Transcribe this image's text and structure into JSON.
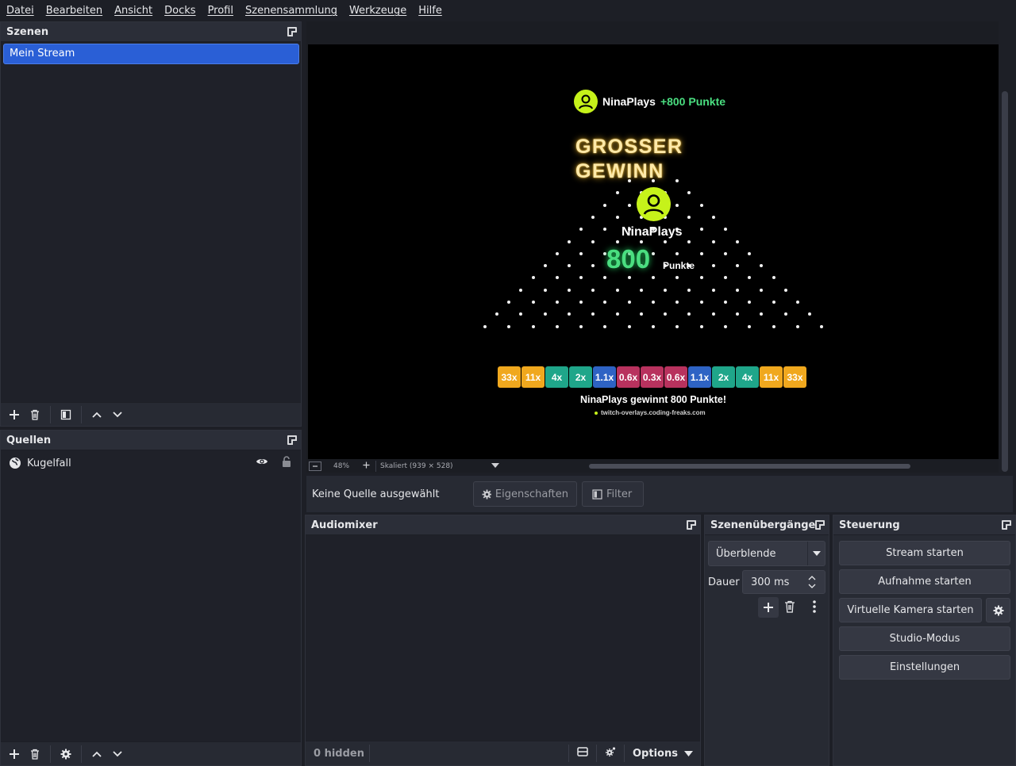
{
  "menu": [
    "Datei",
    "Bearbeiten",
    "Ansicht",
    "Docks",
    "Profil",
    "Szenensammlung",
    "Werkzeuge",
    "Hilfe"
  ],
  "scenes": {
    "title": "Szenen",
    "items": [
      "Mein Stream"
    ]
  },
  "sources": {
    "title": "Quellen",
    "items": [
      "Kugelfall"
    ]
  },
  "preview": {
    "toast_user": "NinaPlays",
    "toast_points": "+800 Punkte",
    "big_win_line1": "GROSSER",
    "big_win_line2": "GEWINN",
    "center_user": "NinaPlays",
    "center_points": "800",
    "center_points_label": "Punkte",
    "multipliers": [
      "33x",
      "11x",
      "4x",
      "2x",
      "1.1x",
      "0.6x",
      "0.3x",
      "0.6x",
      "1.1x",
      "2x",
      "4x",
      "11x",
      "33x"
    ],
    "multiplier_colors": [
      "#f0a81e",
      "#f0a81e",
      "#1fa68a",
      "#1fa68a",
      "#2e63c4",
      "#b8325e",
      "#b8325e",
      "#b8325e",
      "#2e63c4",
      "#1fa68a",
      "#1fa68a",
      "#f0a81e",
      "#f0a81e"
    ],
    "result_text": "NinaPlays gewinnt 800 Punkte!",
    "footer_url": "twitch-overlays.coding-freaks.com"
  },
  "zoombar": {
    "zoom": "48%",
    "scale_label": "Skaliert (939 × 528)"
  },
  "context": {
    "no_source": "Keine Quelle ausgewählt",
    "properties": "Eigenschaften",
    "filters": "Filter"
  },
  "audiomixer": {
    "title": "Audiomixer",
    "hidden": "0 hidden",
    "options": "Options"
  },
  "transitions": {
    "title": "Szenenübergänge",
    "selected": "Überblende",
    "duration_label": "Dauer",
    "duration_value": "300 ms"
  },
  "controls": {
    "title": "Steuerung",
    "stream": "Stream starten",
    "record": "Aufnahme starten",
    "virtual_cam": "Virtuelle Kamera starten",
    "studio": "Studio-Modus",
    "settings": "Einstellungen"
  },
  "colors": {
    "accent": "#2a5fd6",
    "toast_green": "#4ade80",
    "avatar_lime": "#c6f21a",
    "win_gold": "#ffe9a8"
  }
}
